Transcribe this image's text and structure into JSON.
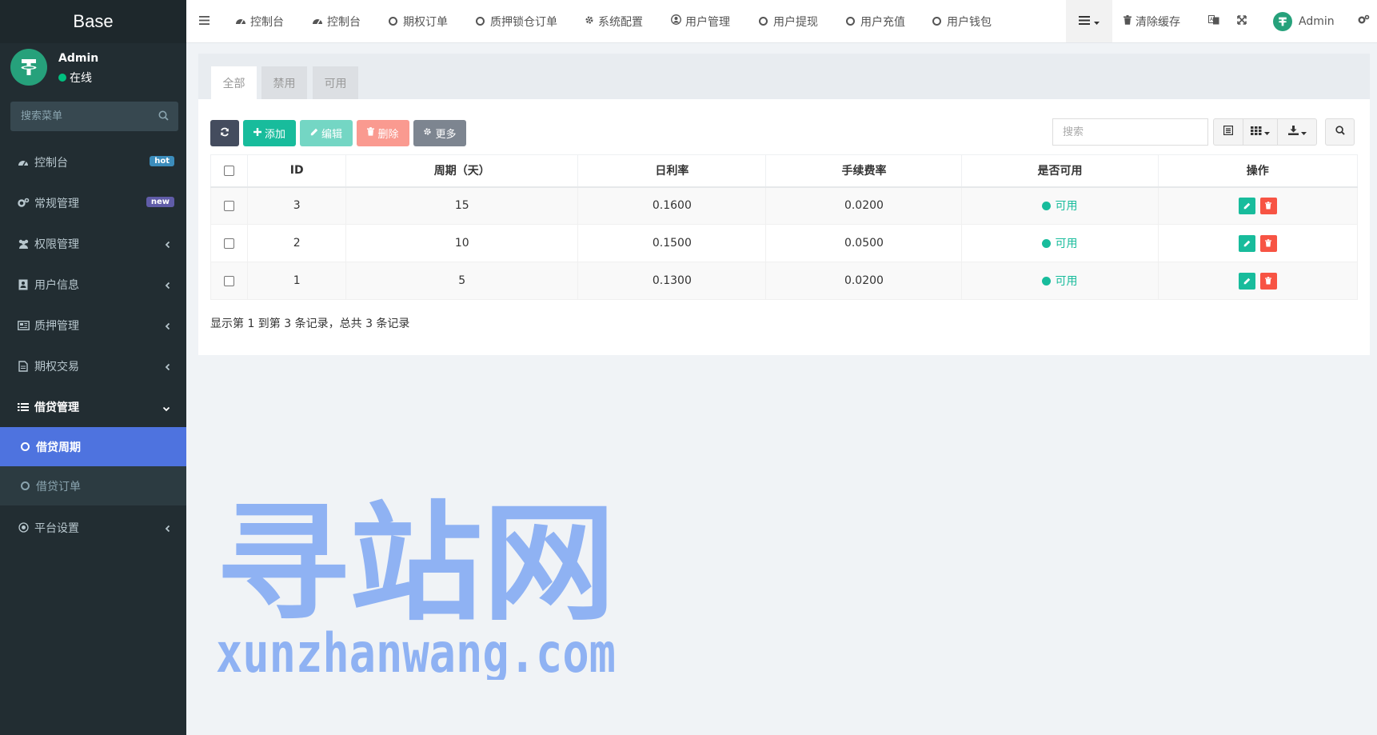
{
  "sidebar": {
    "brand": "Base",
    "user": {
      "name": "Admin",
      "status": "在线"
    },
    "search_placeholder": "搜索菜单",
    "items": [
      {
        "label": "控制台",
        "badge": "hot"
      },
      {
        "label": "常规管理",
        "badge": "new"
      },
      {
        "label": "权限管理"
      },
      {
        "label": "用户信息"
      },
      {
        "label": "质押管理"
      },
      {
        "label": "期权交易"
      },
      {
        "label": "借贷管理"
      },
      {
        "label": "平台设置"
      }
    ],
    "submenu": [
      {
        "label": "借贷周期"
      },
      {
        "label": "借贷订单"
      }
    ]
  },
  "topbar": {
    "nav": [
      "控制台",
      "控制台",
      "期权订单",
      "质押锁仓订单",
      "系统配置",
      "用户管理",
      "用户提现",
      "用户充值",
      "用户钱包"
    ],
    "clear_cache": "清除缓存",
    "admin": "Admin"
  },
  "tabs": [
    "全部",
    "禁用",
    "可用"
  ],
  "toolbar": {
    "add": "添加",
    "edit": "编辑",
    "delete": "删除",
    "more": "更多",
    "search_placeholder": "搜索"
  },
  "table": {
    "headers": [
      "ID",
      "周期（天）",
      "日利率",
      "手续费率",
      "是否可用",
      "操作"
    ],
    "rows": [
      {
        "id": "3",
        "period": "15",
        "rate": "0.1600",
        "fee": "0.0200",
        "status": "可用"
      },
      {
        "id": "2",
        "period": "10",
        "rate": "0.1500",
        "fee": "0.0500",
        "status": "可用"
      },
      {
        "id": "1",
        "period": "5",
        "rate": "0.1300",
        "fee": "0.0200",
        "status": "可用"
      }
    ]
  },
  "pagination": "显示第 1 到第 3 条记录，总共 3 条记录",
  "watermark": {
    "title": "寻站网",
    "url": "xunzhanwang.com"
  },
  "colors": {
    "sidebar": "#222d32",
    "active": "#4e73df",
    "success": "#18bc9c",
    "danger": "#f75444",
    "primary_dark": "#444c5e"
  }
}
